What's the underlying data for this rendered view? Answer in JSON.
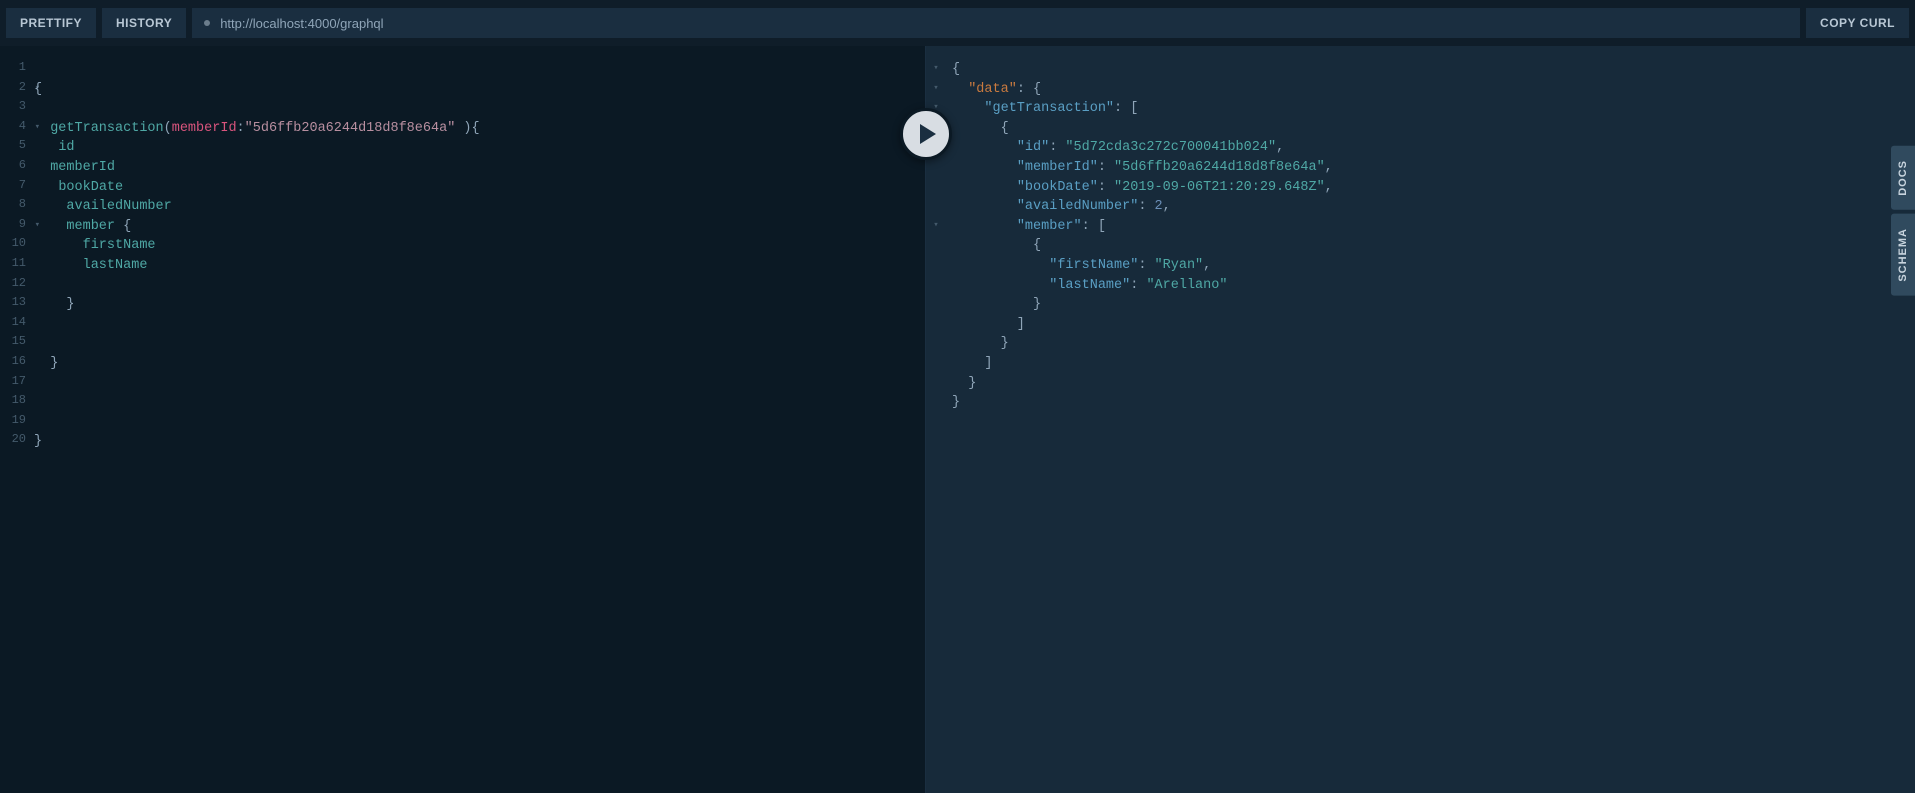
{
  "toolbar": {
    "prettify": "PRETTIFY",
    "history": "HISTORY",
    "url": "http://localhost:4000/graphql",
    "copy_curl": "COPY CURL"
  },
  "side": {
    "docs": "DOCS",
    "schema": "SCHEMA"
  },
  "query": {
    "lines": [
      {
        "n": "1",
        "fold": "",
        "tokens": []
      },
      {
        "n": "2",
        "fold": "▾",
        "tokens": [
          {
            "cls": "tok-punc",
            "t": "{"
          }
        ]
      },
      {
        "n": "3",
        "fold": "",
        "tokens": []
      },
      {
        "n": "4",
        "fold": "▾",
        "tokens": [
          {
            "cls": "tok-punc",
            "t": "  "
          },
          {
            "cls": "tok-field",
            "t": "getTransaction"
          },
          {
            "cls": "tok-punc",
            "t": "("
          },
          {
            "cls": "tok-arg",
            "t": "memberId"
          },
          {
            "cls": "tok-punc",
            "t": ":"
          },
          {
            "cls": "tok-string",
            "t": "\"5d6ffb20a6244d18d8f8e64a\""
          },
          {
            "cls": "tok-punc",
            "t": " ){"
          }
        ]
      },
      {
        "n": "5",
        "fold": "",
        "tokens": [
          {
            "cls": "tok-punc",
            "t": "   "
          },
          {
            "cls": "tok-field",
            "t": "id"
          }
        ]
      },
      {
        "n": "6",
        "fold": "",
        "tokens": [
          {
            "cls": "tok-punc",
            "t": "  "
          },
          {
            "cls": "tok-field",
            "t": "memberId"
          }
        ]
      },
      {
        "n": "7",
        "fold": "",
        "tokens": [
          {
            "cls": "tok-punc",
            "t": "   "
          },
          {
            "cls": "tok-field",
            "t": "bookDate"
          }
        ]
      },
      {
        "n": "8",
        "fold": "",
        "tokens": [
          {
            "cls": "tok-punc",
            "t": "    "
          },
          {
            "cls": "tok-field",
            "t": "availedNumber"
          }
        ]
      },
      {
        "n": "9",
        "fold": "▾",
        "tokens": [
          {
            "cls": "tok-punc",
            "t": "    "
          },
          {
            "cls": "tok-field",
            "t": "member"
          },
          {
            "cls": "tok-punc",
            "t": " {"
          }
        ]
      },
      {
        "n": "10",
        "fold": "",
        "tokens": [
          {
            "cls": "tok-punc",
            "t": "      "
          },
          {
            "cls": "tok-field",
            "t": "firstName"
          }
        ]
      },
      {
        "n": "11",
        "fold": "",
        "tokens": [
          {
            "cls": "tok-punc",
            "t": "      "
          },
          {
            "cls": "tok-field",
            "t": "lastName"
          }
        ]
      },
      {
        "n": "12",
        "fold": "",
        "tokens": []
      },
      {
        "n": "13",
        "fold": "",
        "tokens": [
          {
            "cls": "tok-punc",
            "t": "    }"
          }
        ]
      },
      {
        "n": "14",
        "fold": "",
        "tokens": []
      },
      {
        "n": "15",
        "fold": "",
        "tokens": []
      },
      {
        "n": "16",
        "fold": "",
        "tokens": [
          {
            "cls": "tok-punc",
            "t": "  }"
          }
        ]
      },
      {
        "n": "17",
        "fold": "",
        "tokens": []
      },
      {
        "n": "18",
        "fold": "",
        "tokens": []
      },
      {
        "n": "19",
        "fold": "",
        "tokens": []
      },
      {
        "n": "20",
        "fold": "",
        "tokens": [
          {
            "cls": "tok-punc",
            "t": "}"
          }
        ]
      }
    ]
  },
  "result": {
    "lines": [
      {
        "fold": "▾",
        "tokens": [
          {
            "cls": "tok-brace",
            "t": "{"
          }
        ]
      },
      {
        "fold": "▾",
        "tokens": [
          {
            "cls": "tok-brace",
            "t": "  "
          },
          {
            "cls": "tok-data",
            "t": "\"data\""
          },
          {
            "cls": "tok-brace",
            "t": ": {"
          }
        ]
      },
      {
        "fold": "▾",
        "tokens": [
          {
            "cls": "tok-brace",
            "t": "    "
          },
          {
            "cls": "tok-key",
            "t": "\"getTransaction\""
          },
          {
            "cls": "tok-brace",
            "t": ": ["
          }
        ]
      },
      {
        "fold": "▾",
        "tokens": [
          {
            "cls": "tok-brace",
            "t": "      {"
          }
        ]
      },
      {
        "fold": "",
        "tokens": [
          {
            "cls": "tok-brace",
            "t": "        "
          },
          {
            "cls": "tok-key",
            "t": "\"id\""
          },
          {
            "cls": "tok-brace",
            "t": ": "
          },
          {
            "cls": "tok-val-str",
            "t": "\"5d72cda3c272c700041bb024\""
          },
          {
            "cls": "tok-brace",
            "t": ","
          }
        ]
      },
      {
        "fold": "",
        "tokens": [
          {
            "cls": "tok-brace",
            "t": "        "
          },
          {
            "cls": "tok-key",
            "t": "\"memberId\""
          },
          {
            "cls": "tok-brace",
            "t": ": "
          },
          {
            "cls": "tok-val-str",
            "t": "\"5d6ffb20a6244d18d8f8e64a\""
          },
          {
            "cls": "tok-brace",
            "t": ","
          }
        ]
      },
      {
        "fold": "",
        "tokens": [
          {
            "cls": "tok-brace",
            "t": "        "
          },
          {
            "cls": "tok-key",
            "t": "\"bookDate\""
          },
          {
            "cls": "tok-brace",
            "t": ": "
          },
          {
            "cls": "tok-val-str",
            "t": "\"2019-09-06T21:20:29.648Z\""
          },
          {
            "cls": "tok-brace",
            "t": ","
          }
        ]
      },
      {
        "fold": "",
        "tokens": [
          {
            "cls": "tok-brace",
            "t": "        "
          },
          {
            "cls": "tok-key",
            "t": "\"availedNumber\""
          },
          {
            "cls": "tok-brace",
            "t": ": "
          },
          {
            "cls": "tok-val-num",
            "t": "2"
          },
          {
            "cls": "tok-brace",
            "t": ","
          }
        ]
      },
      {
        "fold": "▾",
        "tokens": [
          {
            "cls": "tok-brace",
            "t": "        "
          },
          {
            "cls": "tok-key",
            "t": "\"member\""
          },
          {
            "cls": "tok-brace",
            "t": ": ["
          }
        ]
      },
      {
        "fold": "",
        "tokens": [
          {
            "cls": "tok-brace",
            "t": "          {"
          }
        ]
      },
      {
        "fold": "",
        "tokens": [
          {
            "cls": "tok-brace",
            "t": "            "
          },
          {
            "cls": "tok-key",
            "t": "\"firstName\""
          },
          {
            "cls": "tok-brace",
            "t": ": "
          },
          {
            "cls": "tok-val-str",
            "t": "\"Ryan\""
          },
          {
            "cls": "tok-brace",
            "t": ","
          }
        ]
      },
      {
        "fold": "",
        "tokens": [
          {
            "cls": "tok-brace",
            "t": "            "
          },
          {
            "cls": "tok-key",
            "t": "\"lastName\""
          },
          {
            "cls": "tok-brace",
            "t": ": "
          },
          {
            "cls": "tok-val-str",
            "t": "\"Arellano\""
          }
        ]
      },
      {
        "fold": "",
        "tokens": [
          {
            "cls": "tok-brace",
            "t": "          }"
          }
        ]
      },
      {
        "fold": "",
        "tokens": [
          {
            "cls": "tok-brace",
            "t": "        ]"
          }
        ]
      },
      {
        "fold": "",
        "tokens": [
          {
            "cls": "tok-brace",
            "t": "      }"
          }
        ]
      },
      {
        "fold": "",
        "tokens": [
          {
            "cls": "tok-brace",
            "t": "    ]"
          }
        ]
      },
      {
        "fold": "",
        "tokens": [
          {
            "cls": "tok-brace",
            "t": "  }"
          }
        ]
      },
      {
        "fold": "",
        "tokens": [
          {
            "cls": "tok-brace",
            "t": "}"
          }
        ]
      }
    ]
  }
}
